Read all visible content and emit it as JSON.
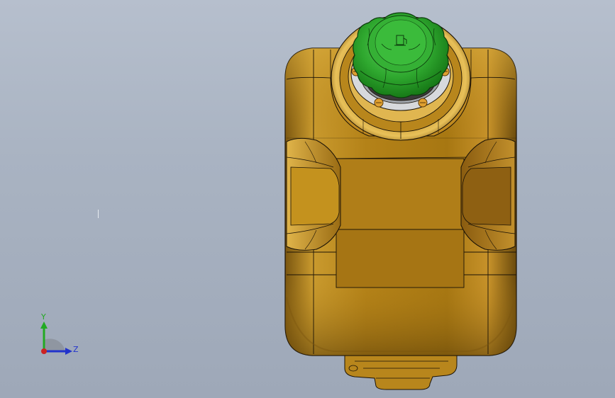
{
  "viewport": {
    "background_top": "#b6bfcd",
    "background_bottom": "#9ea8b8"
  },
  "model": {
    "body_color": "#b8861c",
    "body_highlight": "#e6c05a",
    "body_shadow": "#6e4e10",
    "edge_color": "#1a1206",
    "cap_color": "#2fa82f",
    "cap_highlight": "#7ee07e",
    "cap_shadow": "#156815",
    "ring_color": "#d7d9dc",
    "screw_color": "#e0a030"
  },
  "triad": {
    "y_label": "Y",
    "z_label": "Z",
    "y_color": "#22aa22",
    "z_color": "#2233cc",
    "x_color": "#cc2222"
  }
}
